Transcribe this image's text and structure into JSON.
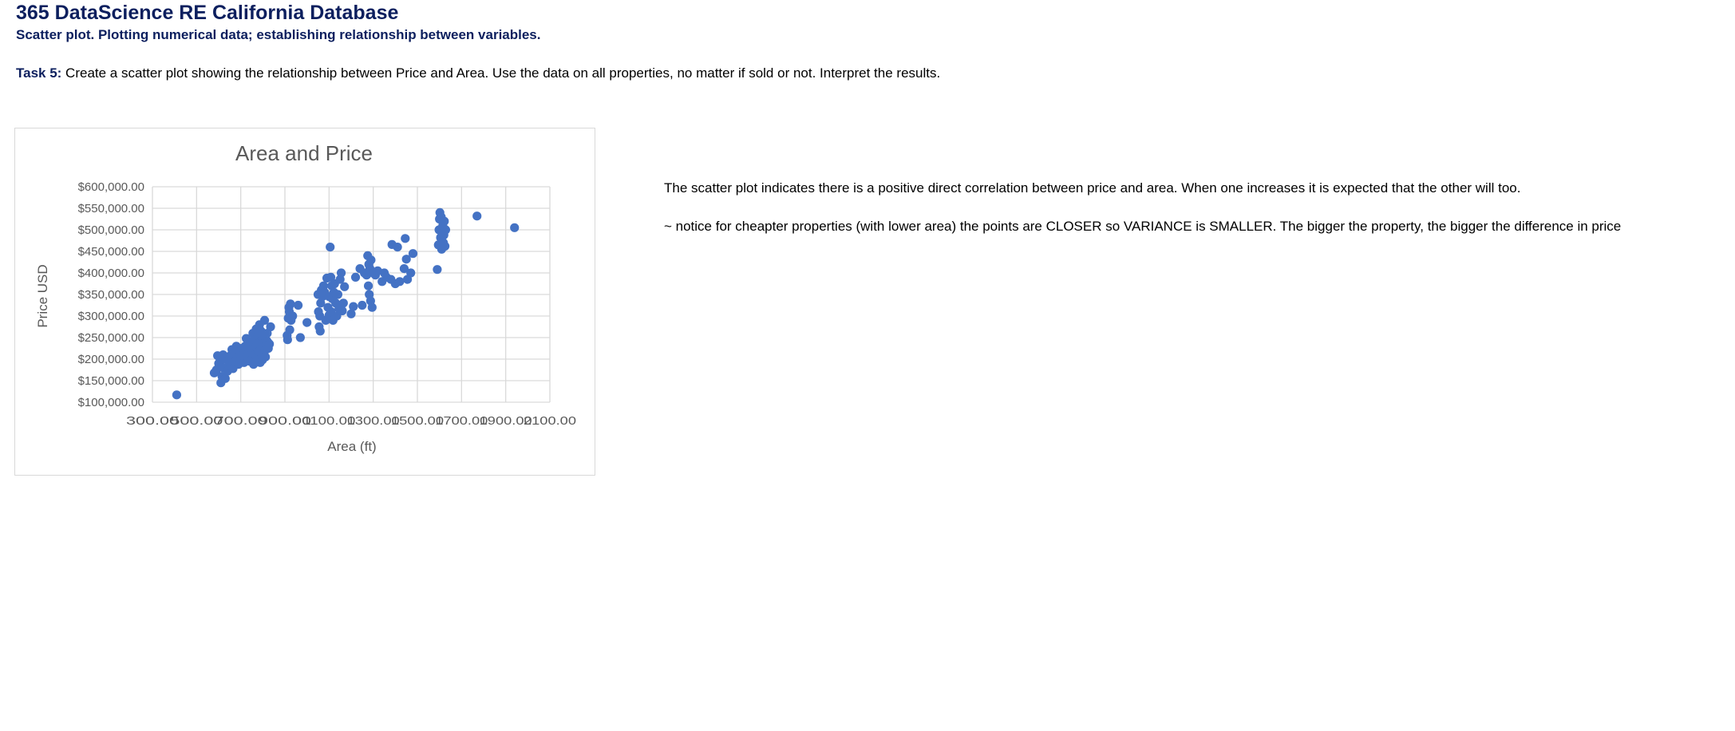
{
  "header": {
    "title": "365 DataScience RE California Database",
    "subtitle": "Scatter plot. Plotting numerical data; establishing relationship between variables."
  },
  "task": {
    "label": "Task 5:",
    "text": " Create a scatter plot showing the relationship between Price and Area. Use the data on all properties, no matter if sold or not. Interpret the results."
  },
  "notes": {
    "interpretation": "The scatter plot indicates there is a positive direct correlation between price and area. When one increases it is expected that the other will too.",
    "variance": "~ notice for cheapter properties (with lower area) the points are CLOSER so VARIANCE is SMALLER. The bigger the property, the bigger the difference in price"
  },
  "colors": {
    "marker": "#4472c4",
    "grid": "#d9d9d9",
    "text": "#595959",
    "heading": "#0c1f5e"
  },
  "chart_data": {
    "type": "scatter",
    "title": "Area and Price",
    "xlabel": "Area (ft)",
    "ylabel": "Price USD",
    "xlim": [
      300,
      2100
    ],
    "ylim": [
      100000,
      600000
    ],
    "grid": true,
    "x_ticks": [
      "300.00",
      "500.00",
      "700.00",
      "900.00",
      "1100.00",
      "1300.00",
      "1500.00",
      "1700.00",
      "1900.00",
      "2100.00"
    ],
    "y_ticks": [
      "$100,000.00",
      "$150,000.00",
      "$200,000.00",
      "$250,000.00",
      "$300,000.00",
      "$350,000.00",
      "$400,000.00",
      "$450,000.00",
      "$500,000.00",
      "$550,000.00",
      "$600,000.00"
    ],
    "series": [
      {
        "points": [
          [
            410,
            117000
          ],
          [
            580,
            168000
          ],
          [
            590,
            175000
          ],
          [
            595,
            208000
          ],
          [
            600,
            190000
          ],
          [
            610,
            145000
          ],
          [
            615,
            160000
          ],
          [
            620,
            210000
          ],
          [
            620,
            180000
          ],
          [
            625,
            200000
          ],
          [
            630,
            155000
          ],
          [
            640,
            172000
          ],
          [
            645,
            195000
          ],
          [
            650,
            207000
          ],
          [
            655,
            185000
          ],
          [
            660,
            222000
          ],
          [
            665,
            178000
          ],
          [
            670,
            212000
          ],
          [
            675,
            195000
          ],
          [
            680,
            230000
          ],
          [
            685,
            205000
          ],
          [
            690,
            188000
          ],
          [
            695,
            218000
          ],
          [
            700,
            200000
          ],
          [
            705,
            225000
          ],
          [
            710,
            213000
          ],
          [
            715,
            192000
          ],
          [
            720,
            230000
          ],
          [
            725,
            248000
          ],
          [
            730,
            205000
          ],
          [
            735,
            215000
          ],
          [
            740,
            195000
          ],
          [
            745,
            238000
          ],
          [
            750,
            222000
          ],
          [
            752,
            200000
          ],
          [
            755,
            260000
          ],
          [
            758,
            188000
          ],
          [
            760,
            245000
          ],
          [
            765,
            210000
          ],
          [
            768,
            228000
          ],
          [
            770,
            270000
          ],
          [
            772,
            195000
          ],
          [
            775,
            235000
          ],
          [
            778,
            255000
          ],
          [
            780,
            205000
          ],
          [
            782,
            218000
          ],
          [
            785,
            280000
          ],
          [
            788,
            192000
          ],
          [
            790,
            240000
          ],
          [
            792,
            265000
          ],
          [
            795,
            225000
          ],
          [
            798,
            198000
          ],
          [
            800,
            250000
          ],
          [
            802,
            212000
          ],
          [
            805,
            236000
          ],
          [
            808,
            290000
          ],
          [
            810,
            220000
          ],
          [
            812,
            205000
          ],
          [
            815,
            245000
          ],
          [
            818,
            230000
          ],
          [
            820,
            260000
          ],
          [
            822,
            240000
          ],
          [
            825,
            225000
          ],
          [
            830,
            235000
          ],
          [
            835,
            275000
          ],
          [
            910,
            255000
          ],
          [
            912,
            245000
          ],
          [
            915,
            295000
          ],
          [
            918,
            320000
          ],
          [
            920,
            310000
          ],
          [
            922,
            268000
          ],
          [
            925,
            328000
          ],
          [
            928,
            290000
          ],
          [
            935,
            300000
          ],
          [
            960,
            325000
          ],
          [
            970,
            250000
          ],
          [
            1000,
            285000
          ],
          [
            1050,
            350000
          ],
          [
            1052,
            310000
          ],
          [
            1055,
            275000
          ],
          [
            1058,
            300000
          ],
          [
            1060,
            265000
          ],
          [
            1062,
            330000
          ],
          [
            1065,
            360000
          ],
          [
            1070,
            345000
          ],
          [
            1075,
            370000
          ],
          [
            1080,
            355000
          ],
          [
            1085,
            290000
          ],
          [
            1090,
            388000
          ],
          [
            1095,
            320000
          ],
          [
            1100,
            345000
          ],
          [
            1100,
            302000
          ],
          [
            1105,
            460000
          ],
          [
            1108,
            390000
          ],
          [
            1110,
            310000
          ],
          [
            1112,
            370000
          ],
          [
            1115,
            340000
          ],
          [
            1118,
            290000
          ],
          [
            1122,
            355000
          ],
          [
            1125,
            375000
          ],
          [
            1130,
            330000
          ],
          [
            1135,
            300000
          ],
          [
            1140,
            350000
          ],
          [
            1145,
            318000
          ],
          [
            1150,
            385000
          ],
          [
            1155,
            400000
          ],
          [
            1160,
            312000
          ],
          [
            1165,
            330000
          ],
          [
            1170,
            368000
          ],
          [
            1200,
            305000
          ],
          [
            1210,
            322000
          ],
          [
            1220,
            390000
          ],
          [
            1240,
            410000
          ],
          [
            1250,
            325000
          ],
          [
            1260,
            400000
          ],
          [
            1270,
            395000
          ],
          [
            1275,
            440000
          ],
          [
            1278,
            370000
          ],
          [
            1280,
            420000
          ],
          [
            1282,
            350000
          ],
          [
            1285,
            410000
          ],
          [
            1288,
            335000
          ],
          [
            1290,
            430000
          ],
          [
            1295,
            320000
          ],
          [
            1300,
            400000
          ],
          [
            1310,
            395000
          ],
          [
            1320,
            405000
          ],
          [
            1340,
            380000
          ],
          [
            1350,
            400000
          ],
          [
            1360,
            390000
          ],
          [
            1380,
            385000
          ],
          [
            1385,
            466000
          ],
          [
            1400,
            375000
          ],
          [
            1410,
            460000
          ],
          [
            1420,
            380000
          ],
          [
            1440,
            410000
          ],
          [
            1445,
            480000
          ],
          [
            1450,
            432000
          ],
          [
            1455,
            385000
          ],
          [
            1470,
            400000
          ],
          [
            1480,
            445000
          ],
          [
            1590,
            408000
          ],
          [
            1595,
            465000
          ],
          [
            1598,
            500000
          ],
          [
            1600,
            525000
          ],
          [
            1602,
            540000
          ],
          [
            1605,
            482000
          ],
          [
            1608,
            530000
          ],
          [
            1610,
            455000
          ],
          [
            1612,
            495000
          ],
          [
            1615,
            510000
          ],
          [
            1618,
            470000
          ],
          [
            1620,
            488000
          ],
          [
            1622,
            520000
          ],
          [
            1625,
            462000
          ],
          [
            1628,
            500000
          ],
          [
            1770,
            532000
          ],
          [
            1940,
            505000
          ]
        ]
      }
    ]
  }
}
